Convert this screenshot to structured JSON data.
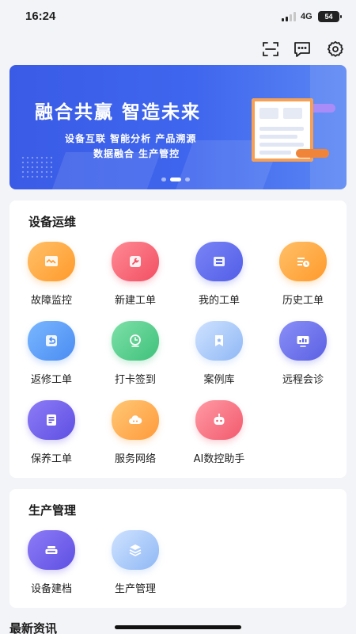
{
  "status_bar": {
    "time": "16:24",
    "network": "4G",
    "battery": "54"
  },
  "top_icons": [
    "scan-icon",
    "message-icon",
    "settings-icon"
  ],
  "banner": {
    "title": "融合共赢  智造未来",
    "subtitle_line1": "设备互联  智能分析  产品溯源",
    "subtitle_line2": "数据融合  生产管控",
    "slide_count": 3,
    "active_slide": 2
  },
  "equipment_section": {
    "title": "设备运维",
    "items": [
      {
        "label": "故障监控",
        "icon": "monitor-icon",
        "color": "#ffa335"
      },
      {
        "label": "新建工单",
        "icon": "wrench-doc-icon",
        "color": "#f2566a"
      },
      {
        "label": "我的工单",
        "icon": "work-order-icon",
        "color": "#5a64ea"
      },
      {
        "label": "历史工单",
        "icon": "history-icon",
        "color": "#ffa335"
      },
      {
        "label": "返修工单",
        "icon": "return-icon",
        "color": "#4f91f4"
      },
      {
        "label": "打卡签到",
        "icon": "location-check-icon",
        "color": "#44c47f"
      },
      {
        "label": "案例库",
        "icon": "bookmark-icon",
        "color": "#93baf5"
      },
      {
        "label": "远程会诊",
        "icon": "remote-monitor-icon",
        "color": "#5e63e4"
      },
      {
        "label": "保养工单",
        "icon": "maintenance-doc-icon",
        "color": "#6053e4"
      },
      {
        "label": "服务网络",
        "icon": "cloud-icon",
        "color": "#ffa33f"
      },
      {
        "label": "AI数控助手",
        "icon": "robot-icon",
        "color": "#f35e71"
      }
    ]
  },
  "production_section": {
    "title": "生产管理",
    "items": [
      {
        "label": "设备建档",
        "icon": "device-icon",
        "color": "#5e4fe3"
      },
      {
        "label": "生产管理",
        "icon": "layers-icon",
        "color": "#93baf5"
      }
    ]
  },
  "news_section": {
    "title": "最新资讯"
  }
}
